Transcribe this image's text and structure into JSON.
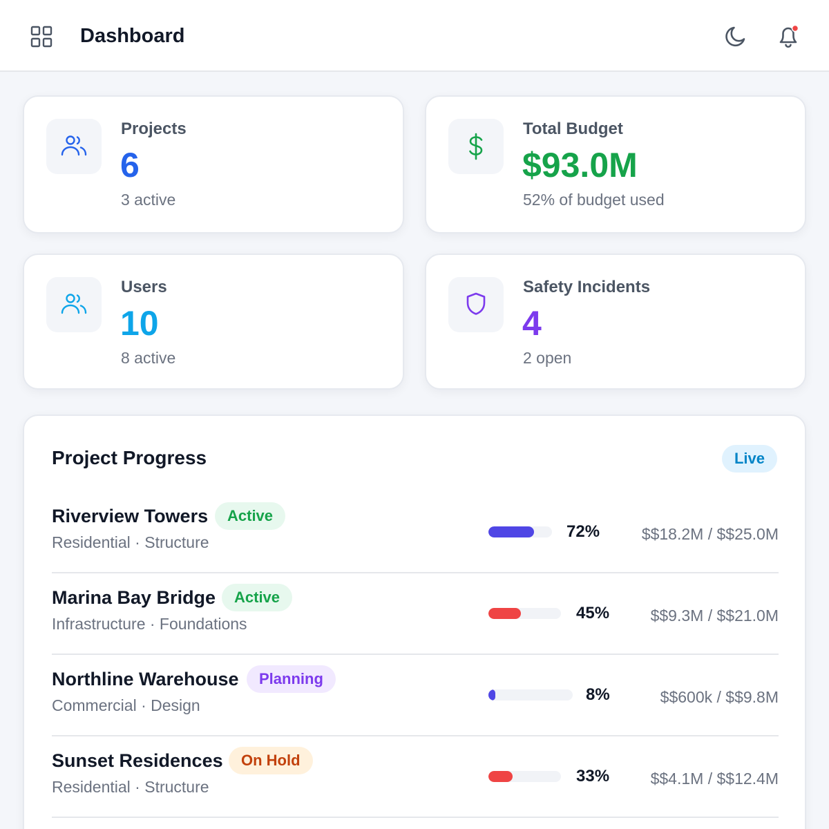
{
  "header": {
    "title": "Dashboard",
    "icons": {
      "menu": "grid-icon",
      "theme": "moon-icon",
      "notifications": "bell-icon"
    },
    "notification_dot_color": "#ef4444"
  },
  "stats": [
    {
      "label": "Projects",
      "value": "6",
      "sub": "3 active",
      "icon": "users-icon",
      "color": "#2563eb"
    },
    {
      "label": "Total Budget",
      "value": "$93.0M",
      "sub": "52% of budget used",
      "icon": "dollar-icon",
      "color": "#16a34a"
    },
    {
      "label": "Users",
      "value": "10",
      "sub": "8 active",
      "icon": "users-icon",
      "color": "#0ea5e9"
    },
    {
      "label": "Safety Incidents",
      "value": "4",
      "sub": "2 open",
      "icon": "shield-icon",
      "color": "#7c3aed"
    }
  ],
  "progress": {
    "title": "Project Progress",
    "badge": "Live",
    "projects": [
      {
        "name": "Riverview Towers",
        "status": "Active",
        "status_type": "active",
        "meta": "Residential · Structure",
        "progress": 72,
        "progress_label": "72%",
        "bar_color": "#4f46e5",
        "budget": "$$18.2M / $$25.0M"
      },
      {
        "name": "Marina Bay Bridge",
        "status": "Active",
        "status_type": "active",
        "meta": "Infrastructure · Foundations",
        "progress": 45,
        "progress_label": "45%",
        "bar_color": "#ef4444",
        "budget": "$$9.3M / $$21.0M"
      },
      {
        "name": "Northline Warehouse",
        "status": "Planning",
        "status_type": "planning",
        "meta": "Commercial · Design",
        "progress": 8,
        "progress_label": "8%",
        "bar_color": "#4f46e5",
        "budget": "$$600k / $$9.8M"
      },
      {
        "name": "Sunset Residences",
        "status": "On Hold",
        "status_type": "hold",
        "meta": "Residential · Structure",
        "progress": 33,
        "progress_label": "33%",
        "bar_color": "#ef4444",
        "budget": "$$4.1M / $$12.4M"
      }
    ]
  }
}
